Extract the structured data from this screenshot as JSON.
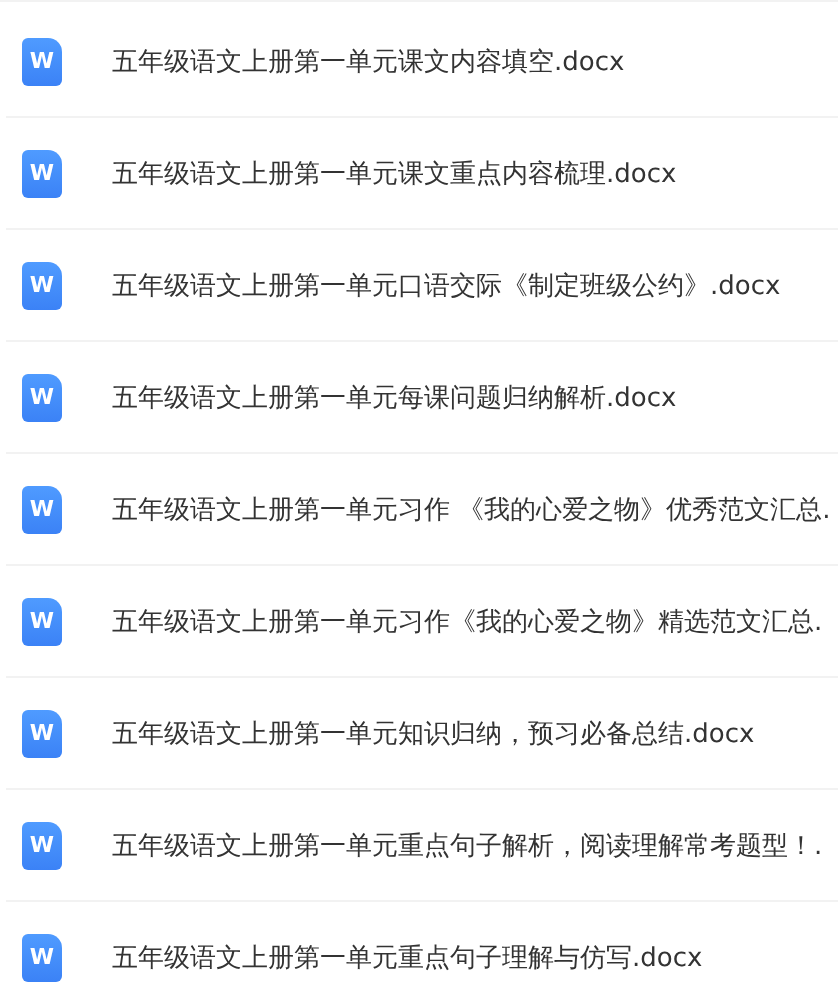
{
  "files": [
    {
      "icon": "W",
      "name": "五年级语文上册第一单元课文内容填空.docx"
    },
    {
      "icon": "W",
      "name": "五年级语文上册第一单元课文重点内容梳理.docx"
    },
    {
      "icon": "W",
      "name": "五年级语文上册第一单元口语交际《制定班级公约》.docx"
    },
    {
      "icon": "W",
      "name": "五年级语文上册第一单元每课问题归纳解析.docx"
    },
    {
      "icon": "W",
      "name": "五年级语文上册第一单元习作 《我的心爱之物》优秀范文汇总."
    },
    {
      "icon": "W",
      "name": "五年级语文上册第一单元习作《我的心爱之物》精选范文汇总."
    },
    {
      "icon": "W",
      "name": "五年级语文上册第一单元知识归纳，预习必备总结.docx"
    },
    {
      "icon": "W",
      "name": "五年级语文上册第一单元重点句子解析，阅读理解常考题型！."
    },
    {
      "icon": "W",
      "name": "五年级语文上册第一单元重点句子理解与仿写.docx"
    }
  ]
}
